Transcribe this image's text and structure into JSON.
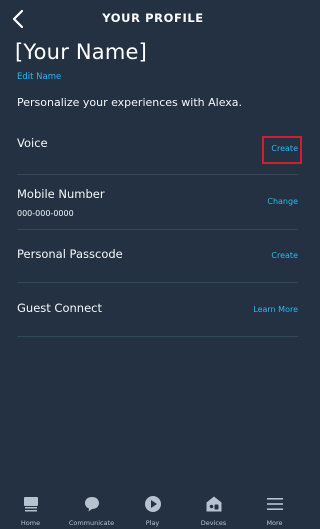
{
  "header": {
    "title": "YOUR PROFILE"
  },
  "profile": {
    "name": "[Your Name]",
    "edit_label": "Edit Name",
    "subtitle": "Personalize your experiences with Alexa."
  },
  "rows": [
    {
      "title": "Voice",
      "sub": "",
      "action": "Create"
    },
    {
      "title": "Mobile Number",
      "sub": "000-000-0000",
      "action": "Change"
    },
    {
      "title": "Personal Passcode",
      "sub": "",
      "action": "Create"
    },
    {
      "title": "Guest Connect",
      "sub": "",
      "action": "Learn More"
    }
  ],
  "nav": [
    {
      "label": "Home",
      "icon": "home-icon"
    },
    {
      "label": "Communicate",
      "icon": "chat-bubble-icon"
    },
    {
      "label": "Play",
      "icon": "play-icon"
    },
    {
      "label": "Devices",
      "icon": "devices-icon"
    },
    {
      "label": "More",
      "icon": "menu-icon"
    }
  ],
  "colors": {
    "background": "#233142",
    "accent": "#2fb8ef",
    "highlight": "#cf1f2c"
  }
}
